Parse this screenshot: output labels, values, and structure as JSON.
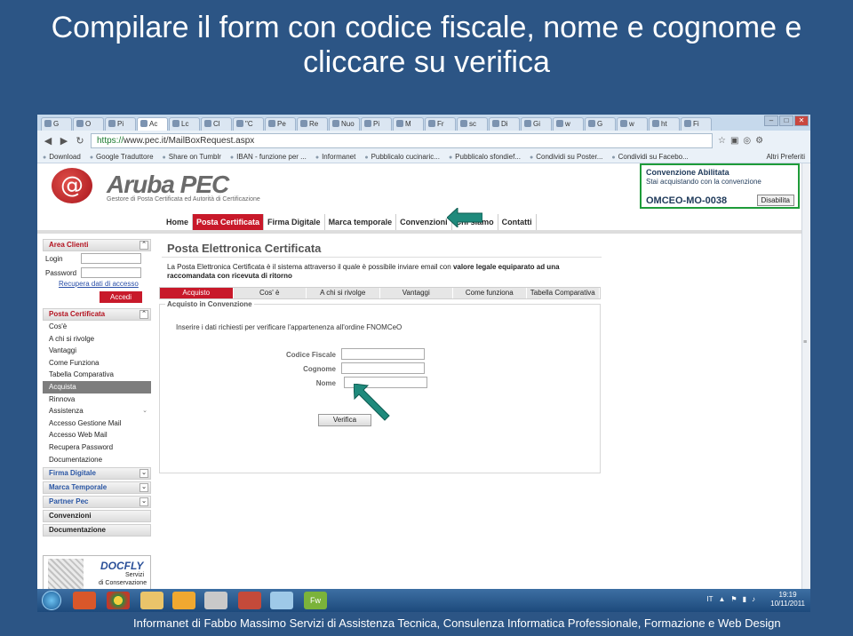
{
  "slide": {
    "title": "Compilare il form con codice fiscale, nome e cognome e cliccare su verifica",
    "footer": "Informanet di Fabbo Massimo Servizi di Assistenza Tecnica, Consulenza Informatica Professionale, Formazione e Web Design"
  },
  "browser": {
    "tabs": [
      {
        "label": "G",
        "active": false
      },
      {
        "label": "O",
        "active": false
      },
      {
        "label": "Pi",
        "active": false
      },
      {
        "label": "Ac",
        "active": true
      },
      {
        "label": "Lc",
        "active": false
      },
      {
        "label": "Cl",
        "active": false
      },
      {
        "label": "\"C",
        "active": false
      },
      {
        "label": "Pe",
        "active": false
      },
      {
        "label": "Re",
        "active": false
      },
      {
        "label": "Nuo",
        "active": false
      },
      {
        "label": "Pi",
        "active": false
      },
      {
        "label": "M",
        "active": false
      },
      {
        "label": "Fr",
        "active": false
      },
      {
        "label": "sc",
        "active": false
      },
      {
        "label": "Di",
        "active": false
      },
      {
        "label": "Gi",
        "active": false
      },
      {
        "label": "w",
        "active": false
      },
      {
        "label": "G",
        "active": false
      },
      {
        "label": "w",
        "active": false
      },
      {
        "label": "ht",
        "active": false
      },
      {
        "label": "Fi",
        "active": false
      }
    ],
    "url_scheme": "https://",
    "url_rest": "www.pec.it/MailBoxRequest.aspx",
    "bookmarks": [
      "Download",
      "Google Traduttore",
      "Share on Tumblr",
      "IBAN - funzione per ...",
      "Informanet",
      "Pubblicalo cucinaric...",
      "Pubblicalo sfondief...",
      "Condividi su Poster...",
      "Condividi su Facebo..."
    ],
    "other_bookmarks": "Altri Preferiti"
  },
  "site": {
    "logo_text": "Aruba PEC",
    "logo_sub": "Gestore di Posta Certificata ed Autorità di Certificazione",
    "convention": {
      "heading": "Convenzione Abilitata",
      "text": "Stai acquistando con la convenzione",
      "code": "OMCEO-MO-0038",
      "button": "Disabilita"
    },
    "topnav": [
      "Home",
      "Posta Certificata",
      "Firma Digitale",
      "Marca temporale",
      "Convenzioni",
      "Chi siamo",
      "Contatti"
    ],
    "sidebar": {
      "area_clienti": "Area Clienti",
      "login_label": "Login",
      "password_label": "Password",
      "recupera": "Recupera dati di accesso",
      "accedi": "Accedi",
      "posta_head": "Posta Certificata",
      "items": [
        "Cos'è",
        "A chi si rivolge",
        "Vantaggi",
        "Come Funziona",
        "Tabella Comparativa",
        "Acquista",
        "Rinnova",
        "Assistenza",
        "Accesso Gestione Mail",
        "Accesso Web Mail",
        "Recupera Password",
        "Documentazione"
      ],
      "firma": "Firma Digitale",
      "marca": "Marca Temporale",
      "partner": "Partner Pec",
      "convenzioni": "Convenzioni",
      "documentazione": "Documentazione"
    },
    "docfly": {
      "name": "DOCFLY",
      "s1": "Servizi",
      "s2": "di Conservazione"
    },
    "main": {
      "title": "Posta Elettronica Certificata",
      "intro_a": "La Posta Elettronica Certificata è il sistema attraverso il quale è possibile inviare email con ",
      "intro_b": "valore legale equiparato ad una raccomandata con ricevuta di ritorno",
      "subtabs": [
        "Acquisto",
        "Cos' è",
        "A chi si rivolge",
        "Vantaggi",
        "Come funziona",
        "Tabella Comparativa"
      ],
      "legend": "Acquisto in Convenzione",
      "instruction": "Inserire i dati richiesti per verificare l'appartenenza all'ordine FNOMCeO",
      "fields": {
        "codice": "Codice Fiscale",
        "cognome": "Cognome",
        "nome": "Nome"
      },
      "verifica": "Verifica"
    }
  },
  "taskbar": {
    "lang": "IT",
    "time": "19:19",
    "date": "10/11/2011"
  },
  "colors": {
    "slide_bg": "#2c5585",
    "brand_red": "#c8192a",
    "arrow": "#1f8a7c"
  }
}
